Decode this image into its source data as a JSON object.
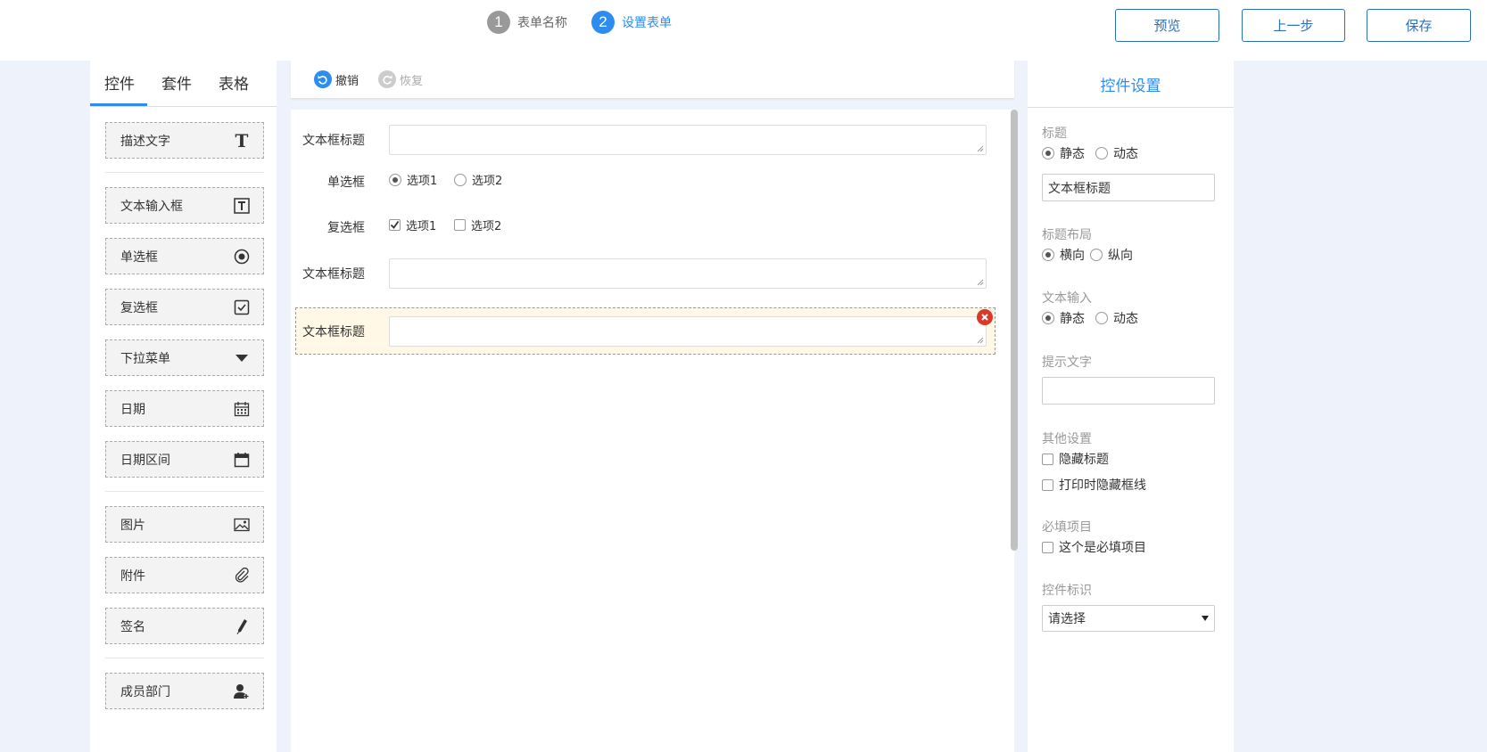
{
  "steps": [
    {
      "num": "1",
      "label": "表单名称"
    },
    {
      "num": "2",
      "label": "设置表单"
    }
  ],
  "actions": {
    "preview": "预览",
    "prev": "上一步",
    "save": "保存"
  },
  "left_tabs": [
    "控件",
    "套件",
    "表格"
  ],
  "components": [
    {
      "label": "描述文字",
      "icon": "text-icon"
    },
    {
      "label": "文本输入框",
      "icon": "textbox-icon"
    },
    {
      "label": "单选框",
      "icon": "radio-icon"
    },
    {
      "label": "复选框",
      "icon": "checkbox-icon"
    },
    {
      "label": "下拉菜单",
      "icon": "dropdown-icon"
    },
    {
      "label": "日期",
      "icon": "calendar-icon"
    },
    {
      "label": "日期区间",
      "icon": "date-range-icon"
    },
    {
      "label": "图片",
      "icon": "image-icon"
    },
    {
      "label": "附件",
      "icon": "paperclip-icon"
    },
    {
      "label": "签名",
      "icon": "pen-icon"
    },
    {
      "label": "成员部门",
      "icon": "add-member-icon"
    }
  ],
  "toolbar": {
    "undo": "撤销",
    "redo": "恢复"
  },
  "form": {
    "field1_label": "文本框标题",
    "radio_label": "单选框",
    "radio_opt1": "选项1",
    "radio_opt2": "选项2",
    "checkbox_label": "复选框",
    "check_opt1": "选项1",
    "check_opt2": "选项2",
    "field2_label": "文本框标题",
    "field3_label": "文本框标题"
  },
  "settings": {
    "title": "控件设置",
    "title_section": "标题",
    "static": "静态",
    "dynamic": "动态",
    "title_value": "文本框标题",
    "layout_section": "标题布局",
    "horizontal": "横向",
    "vertical": "纵向",
    "text_input_section": "文本输入",
    "text_static": "静态",
    "text_dynamic": "动态",
    "hint_section": "提示文字",
    "hint_value": "",
    "other_section": "其他设置",
    "hide_title": "隐藏标题",
    "hide_border_print": "打印时隐藏框线",
    "required_section": "必填项目",
    "required_opt": "这个是必填项目",
    "id_section": "控件标识",
    "id_select": "请选择"
  },
  "colors": {
    "accent": "#2d8cf0",
    "button_border": "#2d6fb8",
    "delete": "#d9382b",
    "selected_bg": "#fff8e6"
  }
}
